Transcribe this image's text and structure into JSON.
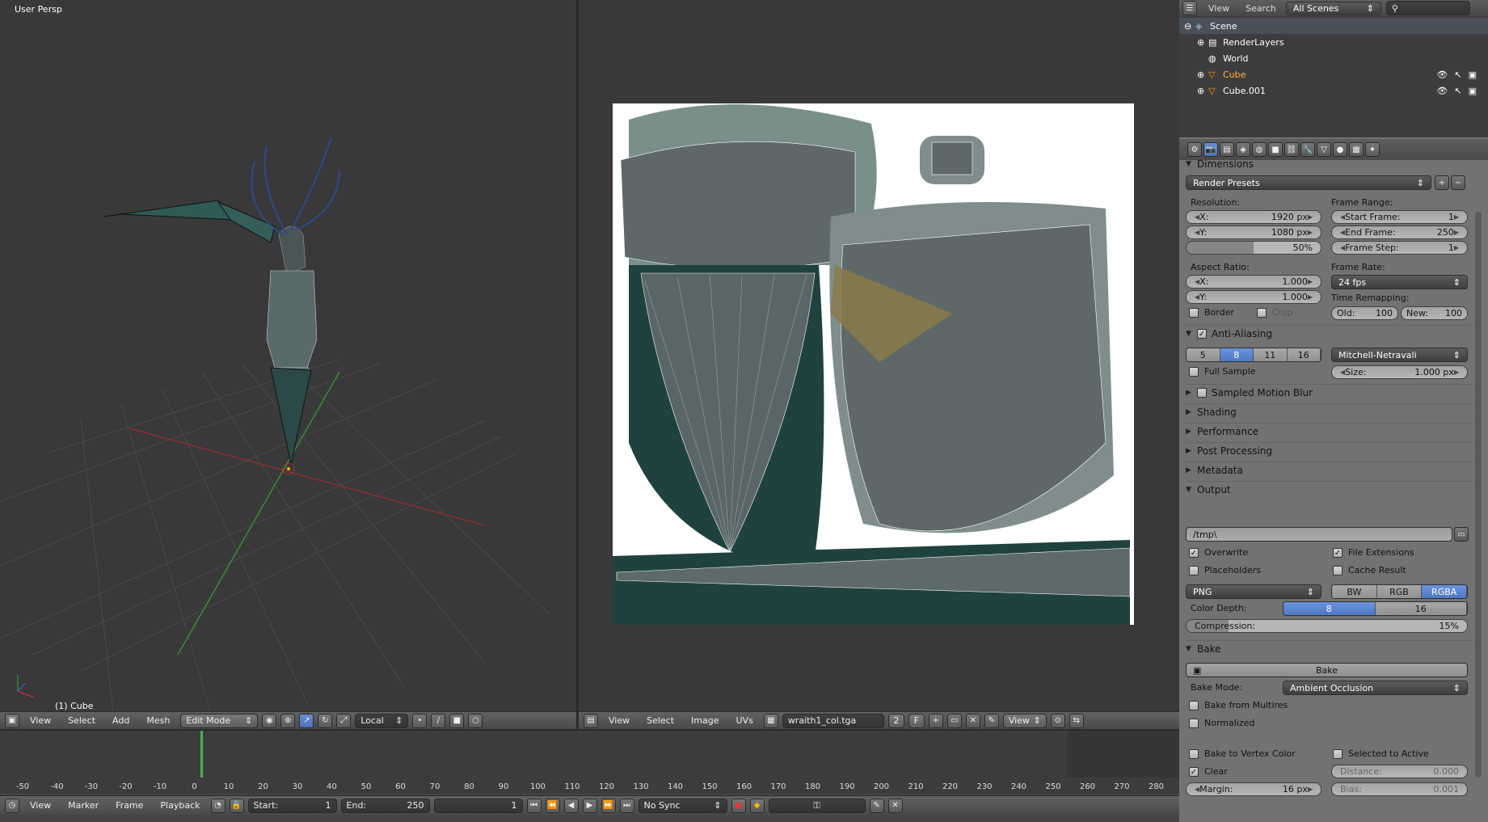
{
  "viewport3d": {
    "label": "User Persp",
    "object_label": "(1) Cube",
    "header": {
      "menus": [
        "View",
        "Select",
        "Add",
        "Mesh"
      ],
      "mode": "Edit Mode",
      "orientation": "Local"
    }
  },
  "uv_editor": {
    "header": {
      "menus": [
        "View",
        "Select",
        "Image",
        "UVs"
      ],
      "image_name": "wraith1_col.tga",
      "users": "2",
      "fake_user": "F",
      "view_mode": "View"
    }
  },
  "outliner": {
    "header": {
      "view": "View",
      "search": "Search",
      "scenes": "All Scenes"
    },
    "items": [
      {
        "label": "Scene"
      },
      {
        "label": "RenderLayers"
      },
      {
        "label": "World"
      },
      {
        "label": "Cube"
      },
      {
        "label": "Cube.001"
      }
    ]
  },
  "properties": {
    "dimensions": {
      "title": "Dimensions",
      "presets": "Render Presets",
      "resolution_label": "Resolution:",
      "res_x_label": "X:",
      "res_x": "1920 px",
      "res_y_label": "Y:",
      "res_y": "1080 px",
      "res_pct": "50%",
      "frame_range_label": "Frame Range:",
      "start_label": "Start Frame:",
      "start": "1",
      "end_label": "End Frame:",
      "end": "250",
      "step_label": "Frame Step:",
      "step": "1",
      "aspect_label": "Aspect Ratio:",
      "asp_x_label": "X:",
      "asp_x": "1.000",
      "asp_y_label": "Y:",
      "asp_y": "1.000",
      "frame_rate_label": "Frame Rate:",
      "frame_rate": "24 fps",
      "border": "Border",
      "crop": "Crop",
      "time_remap_label": "Time Remapping:",
      "old_label": "Old:",
      "old": "100",
      "new_label": "New:",
      "new": "100"
    },
    "anti_aliasing": {
      "title": "Anti-Aliasing",
      "samples": [
        "5",
        "8",
        "11",
        "16"
      ],
      "selected": "8",
      "filter": "Mitchell-Netravali",
      "full_sample": "Full Sample",
      "size_label": "Size:",
      "size": "1.000 px"
    },
    "collapsed": [
      "Sampled Motion Blur",
      "Shading",
      "Performance",
      "Post Processing",
      "Metadata"
    ],
    "output": {
      "title": "Output",
      "path": "/tmp\\",
      "overwrite": "Overwrite",
      "file_ext": "File Extensions",
      "placeholders": "Placeholders",
      "cache": "Cache Result",
      "format": "PNG",
      "color_modes": [
        "BW",
        "RGB",
        "RGBA"
      ],
      "color_selected": "RGBA",
      "depth_label": "Color Depth:",
      "depths": [
        "8",
        "16"
      ],
      "depth_selected": "8",
      "compression_label": "Compression:",
      "compression": "15%"
    },
    "bake": {
      "title": "Bake",
      "button": "Bake",
      "mode_label": "Bake Mode:",
      "mode": "Ambient Occlusion",
      "from_multires": "Bake from Multires",
      "normalized": "Normalized",
      "to_vertex": "Bake to Vertex Color",
      "selected_active": "Selected to Active",
      "clear": "Clear",
      "distance_label": "Distance:",
      "distance": "0.000",
      "margin_label": "Margin:",
      "margin": "16 px",
      "bias_label": "Bias:",
      "bias": "0.001"
    }
  },
  "timeline": {
    "ticks": [
      "-50",
      "-40",
      "-30",
      "-20",
      "-10",
      "0",
      "10",
      "20",
      "30",
      "40",
      "50",
      "60",
      "70",
      "80",
      "90",
      "100",
      "110",
      "120",
      "130",
      "140",
      "150",
      "160",
      "170",
      "180",
      "190",
      "200",
      "210",
      "220",
      "230",
      "240",
      "250",
      "260",
      "270",
      "280"
    ],
    "menus": [
      "View",
      "Marker",
      "Frame",
      "Playback"
    ],
    "start_label": "Start:",
    "start": "1",
    "end_label": "End:",
    "end": "250",
    "current": "1",
    "sync": "No Sync"
  }
}
